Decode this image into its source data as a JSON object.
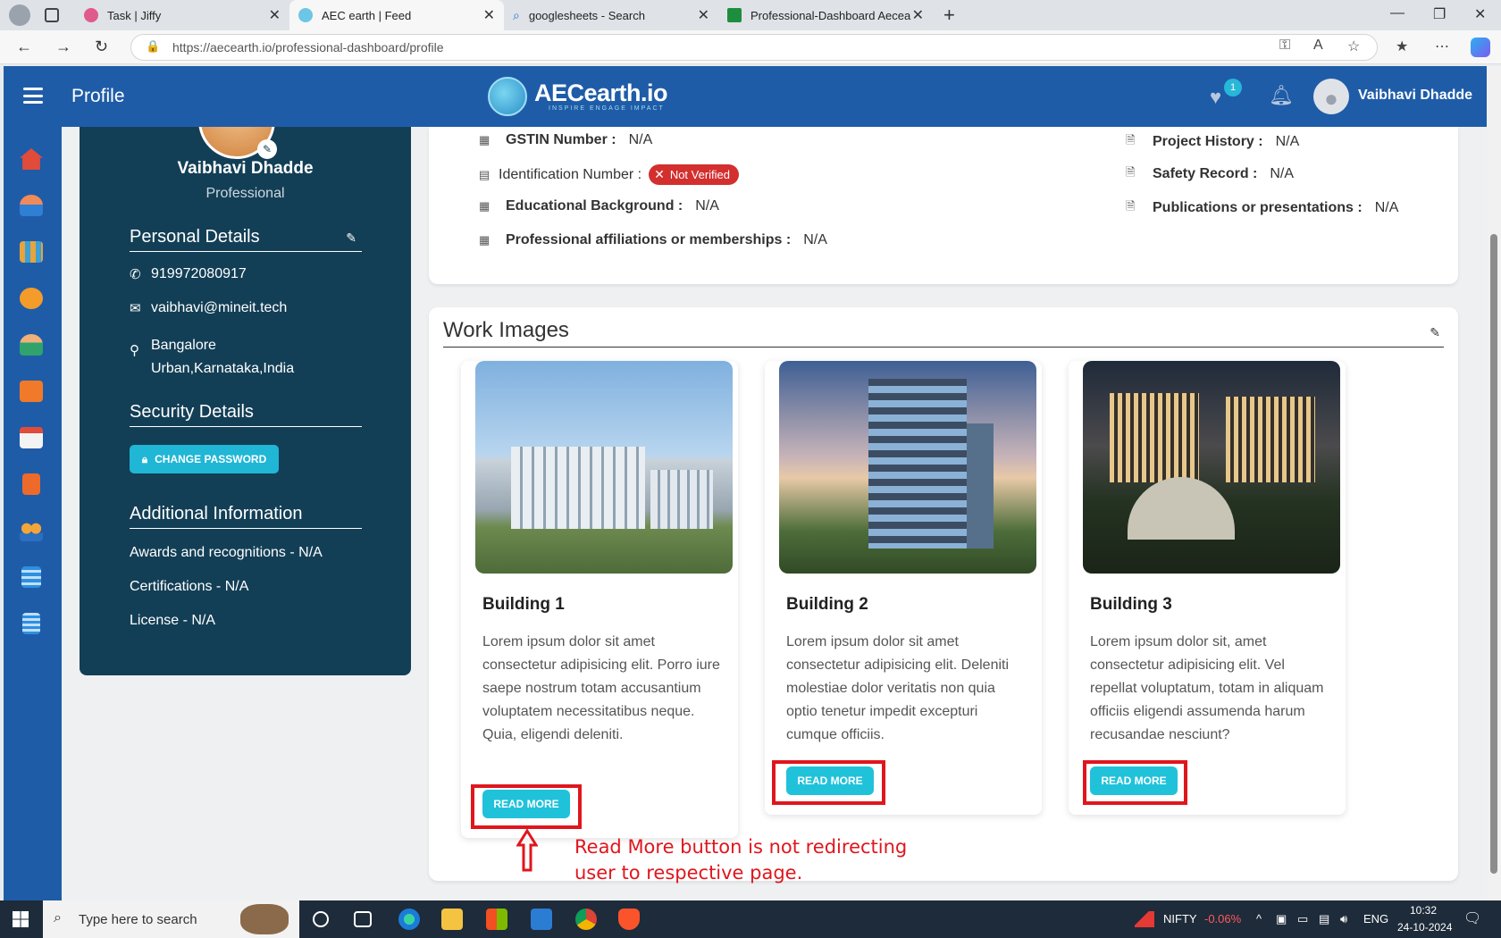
{
  "browser": {
    "tabs": [
      {
        "label": "Task | Jiffy"
      },
      {
        "label": "AEC earth | Feed"
      },
      {
        "label": "googlesheets - Search"
      },
      {
        "label": "Professional-Dashboard Aecearth"
      }
    ],
    "url": "https://aecearth.io/professional-dashboard/profile"
  },
  "header": {
    "title": "Profile",
    "logo_text": "AECearth.io",
    "logo_tagline": "INSPIRE ENGAGE IMPACT",
    "wishlist_badge": "1",
    "user_name": "Vaibhavi Dhadde"
  },
  "profile": {
    "name": "Vaibhavi Dhadde",
    "role": "Professional",
    "personal_heading": "Personal Details",
    "phone": "919972080917",
    "email": "vaibhavi@mineit.tech",
    "location_line1": "Bangalore",
    "location_line2": "Urban,Karnataka,India",
    "security_heading": "Security Details",
    "change_password": "CHANGE PASSWORD",
    "additional_heading": "Additional Information",
    "awards": "Awards and recognitions -  N/A",
    "certifications": "Certifications -  N/A",
    "license": "License -  N/A"
  },
  "details": {
    "gstin_label": "GSTIN Number :",
    "gstin_value": "N/A",
    "id_label": "Identification Number :",
    "id_status": "Not Verified",
    "edu_label": "Educational Background :",
    "edu_value": "N/A",
    "affil_label": "Professional affiliations or memberships :",
    "affil_value": "N/A",
    "project_label": "Project History :",
    "project_value": "N/A",
    "safety_label": "Safety Record :",
    "safety_value": "N/A",
    "pub_label": "Publications or presentations :",
    "pub_value": "N/A"
  },
  "work": {
    "heading": "Work Images",
    "cards": [
      {
        "title": "Building 1",
        "text": "Lorem ipsum dolor sit amet consectetur adipisicing elit. Porro iure saepe nostrum totam accusantium voluptatem necessitatibus neque. Quia, eligendi deleniti.",
        "button": "READ MORE"
      },
      {
        "title": "Building 2",
        "text": "Lorem ipsum dolor sit amet consectetur adipisicing elit. Deleniti molestiae dolor veritatis non quia optio tenetur impedit excepturi cumque officiis.",
        "button": "READ MORE"
      },
      {
        "title": "Building 3",
        "text": "Lorem ipsum dolor sit, amet consectetur adipisicing elit. Vel repellat voluptatum, totam in aliquam officiis eligendi assumenda harum recusandae nesciunt?",
        "button": "READ MORE"
      }
    ]
  },
  "annotation": {
    "line1": "Read More button is not redirecting",
    "line2": "user to respective page."
  },
  "taskbar": {
    "search_placeholder": "Type here to search",
    "ticker_name": "NIFTY",
    "ticker_change": "-0.06%",
    "lang": "ENG",
    "time": "10:32",
    "date": "24-10-2024"
  },
  "colors": {
    "header": "#1f5ca8",
    "profile_card": "#133f56",
    "accent": "#20c2da",
    "annotation": "#e0161d"
  }
}
